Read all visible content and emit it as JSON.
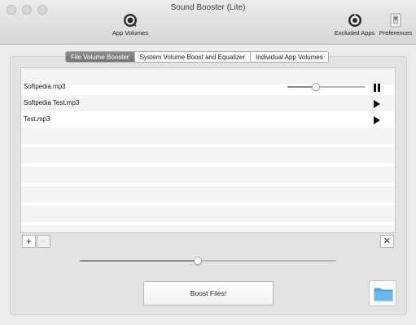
{
  "window": {
    "title": "Sound Booster (Lite)"
  },
  "toolbar": {
    "app_volumes_label": "App Volumes",
    "excluded_apps_label": "Excluded Apps",
    "preferences_label": "Preferences",
    "app_volumes_icon": "speaker-gauge-icon",
    "excluded_apps_icon": "speaker-gauge-icon",
    "preferences_icon": "switch-icon"
  },
  "tabs": [
    {
      "label": "File Volume Booster",
      "active": true
    },
    {
      "label": "System Volume Boost and Equalizer",
      "active": false
    },
    {
      "label": "Individual App Volumes",
      "active": false
    }
  ],
  "files": [
    {
      "name": "Softpedia.mp3",
      "state": "playing",
      "volume": 0.36
    },
    {
      "name": "Softpedia Test.mp3",
      "state": "stopped"
    },
    {
      "name": "Test.mp3",
      "state": "stopped"
    }
  ],
  "list_controls": {
    "add_label": "+",
    "remove_label": "−",
    "clear_label": "✕"
  },
  "boost_level": 0.46,
  "boost_button_label": "Boost Files!",
  "colors": {
    "folder": "#5aa9e6",
    "active_tab": "#7f7f7f"
  }
}
